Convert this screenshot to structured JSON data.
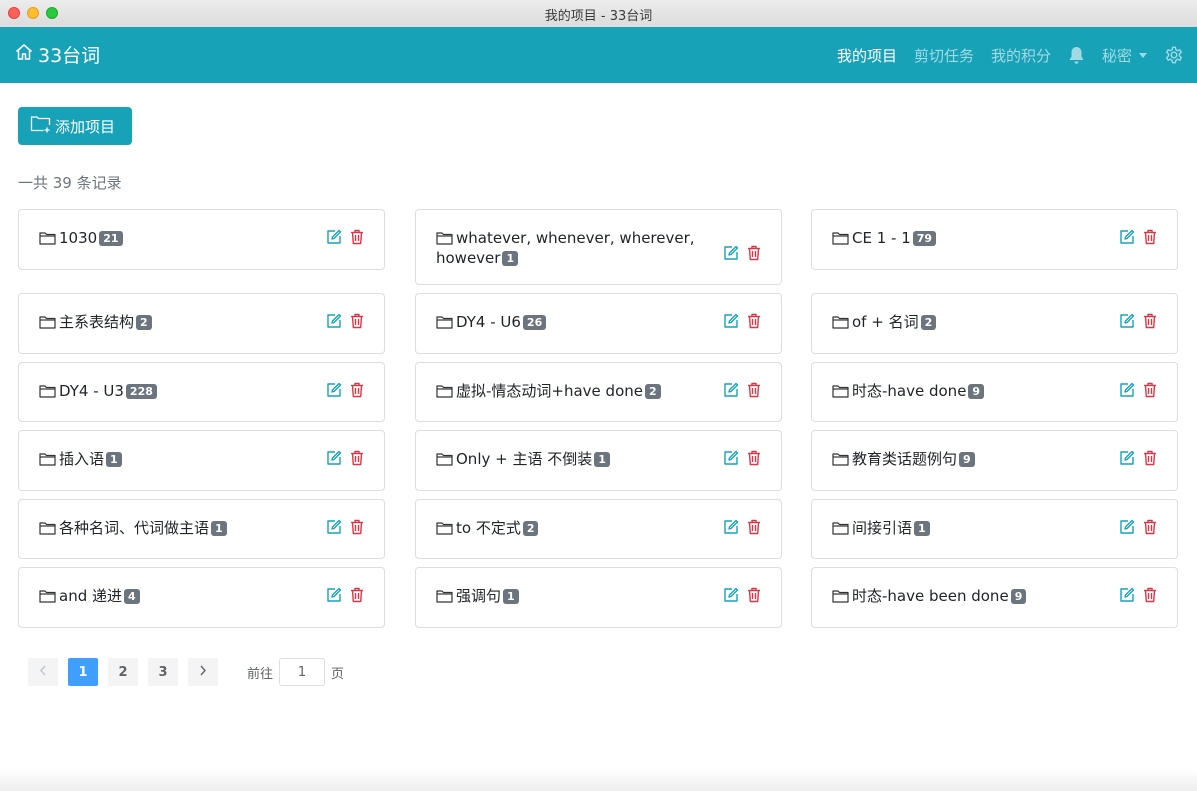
{
  "window": {
    "title": "我的项目 - 33台词"
  },
  "navbar": {
    "brand": "33台词",
    "links": [
      "我的项目",
      "剪切任务",
      "我的积分"
    ],
    "user": "秘密"
  },
  "toolbar": {
    "add_label": "添加项目"
  },
  "summary": "一共 39 条记录",
  "projects": [
    {
      "name": "1030",
      "count": "21"
    },
    {
      "name": "whatever, whenever, wherever, however",
      "count": "1"
    },
    {
      "name": "CE 1 - 1",
      "count": "79"
    },
    {
      "name": "主系表结构",
      "count": "2"
    },
    {
      "name": "DY4 - U6",
      "count": "26"
    },
    {
      "name": "of + 名词",
      "count": "2"
    },
    {
      "name": "DY4 - U3",
      "count": "228"
    },
    {
      "name": "虚拟-情态动词+have done",
      "count": "2"
    },
    {
      "name": "时态-have done",
      "count": "9"
    },
    {
      "name": "插入语",
      "count": "1"
    },
    {
      "name": "Only + 主语 不倒装",
      "count": "1"
    },
    {
      "name": "教育类话题例句",
      "count": "9"
    },
    {
      "name": "各种名词、代词做主语",
      "count": "1"
    },
    {
      "name": "to 不定式",
      "count": "2"
    },
    {
      "name": "间接引语",
      "count": "1"
    },
    {
      "name": "and 递进",
      "count": "4"
    },
    {
      "name": "强调句",
      "count": "1"
    },
    {
      "name": "时态-have been done",
      "count": "9"
    }
  ],
  "pagination": {
    "pages": [
      "1",
      "2",
      "3"
    ],
    "current": "1",
    "goto_prefix": "前往",
    "goto_value": "1",
    "goto_suffix": "页"
  },
  "icons": {
    "brand": "home-icon",
    "notifications": "bell-icon",
    "settings": "gear-icon",
    "add": "folder-plus-icon",
    "folder": "folder-icon",
    "edit": "edit-icon",
    "delete": "trash-icon"
  },
  "colors": {
    "primary": "#17a2b8",
    "danger": "#dc3545",
    "badge": "#6c757d",
    "page_active": "#409eff"
  }
}
